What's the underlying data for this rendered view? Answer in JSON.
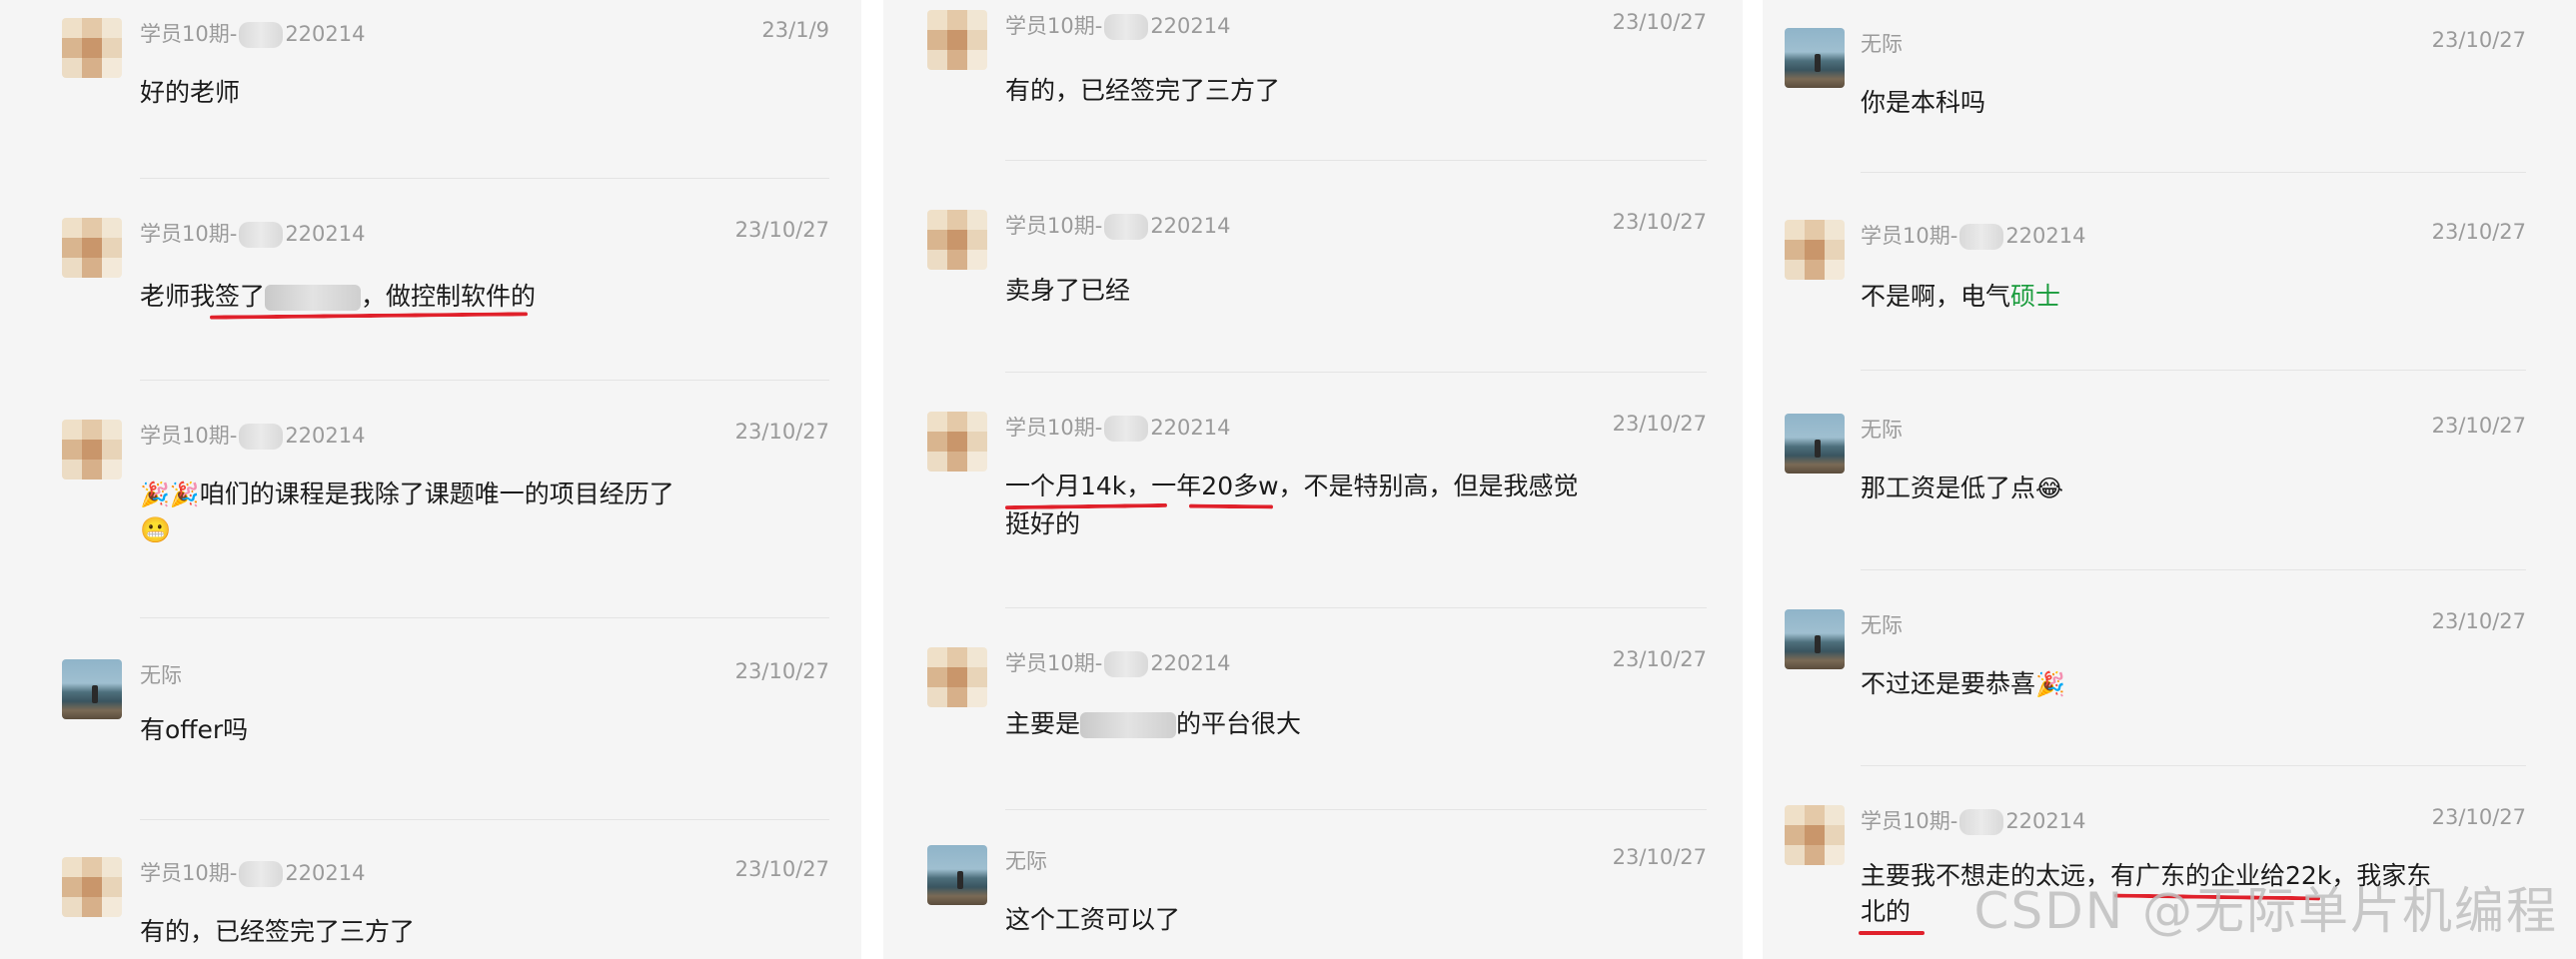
{
  "columns": [
    {
      "messages": [
        {
          "sender": "学员10期-",
          "sender_suffix": "220214",
          "time": "23/1/9",
          "text": "好的老师"
        },
        {
          "sender": "学员10期-",
          "sender_suffix": "220214",
          "time": "23/10/27",
          "text_a": "老师我签了",
          "text_b": "，做控制软件的"
        },
        {
          "sender": "学员10期-",
          "sender_suffix": "220214",
          "time": "23/10/27",
          "emoji": "🎉🎉",
          "text": "咱们的课程是我除了课题唯一的项目经历了",
          "emoji2": "😬"
        },
        {
          "sender": "无际",
          "time": "23/10/27",
          "text": "有offer吗"
        },
        {
          "sender": "学员10期-",
          "sender_suffix": "220214",
          "time": "23/10/27",
          "text": "有的，已经签完了三方了"
        }
      ]
    },
    {
      "messages": [
        {
          "sender": "学员10期-",
          "sender_suffix": "220214",
          "time": "23/10/27",
          "text": "有的，已经签完了三方了"
        },
        {
          "sender": "学员10期-",
          "sender_suffix": "220214",
          "time": "23/10/27",
          "text": "卖身了已经"
        },
        {
          "sender": "学员10期-",
          "sender_suffix": "220214",
          "time": "23/10/27",
          "line1": "一个月14k，一年20多w，不是特别高，但是我感觉",
          "line2": "挺好的"
        },
        {
          "sender": "学员10期-",
          "sender_suffix": "220214",
          "time": "23/10/27",
          "text_a": "主要是",
          "text_b": "的平台很大"
        },
        {
          "sender": "无际",
          "time": "23/10/27",
          "text": "这个工资可以了"
        }
      ]
    },
    {
      "messages": [
        {
          "sender": "无际",
          "time": "23/10/27",
          "text": "你是本科吗"
        },
        {
          "sender": "学员10期-",
          "sender_suffix": "220214",
          "time": "23/10/27",
          "text_a": "不是啊，电气",
          "text_green": "硕士"
        },
        {
          "sender": "无际",
          "time": "23/10/27",
          "text": "那工资是低了点",
          "emoji": "😂"
        },
        {
          "sender": "无际",
          "time": "23/10/27",
          "text": "不过还是要恭喜",
          "emoji": "🎉"
        },
        {
          "sender": "学员10期-",
          "sender_suffix": "220214",
          "time": "23/10/27",
          "line1": "主要我不想走的太远，有广东的企业给22k，我家东",
          "line2": "北的"
        }
      ]
    }
  ],
  "watermark": "CSDN @无际单片机编程",
  "colors": {
    "underline": "#e0212b",
    "green_text": "#1a9c3d",
    "background": "#f5f5f5"
  }
}
